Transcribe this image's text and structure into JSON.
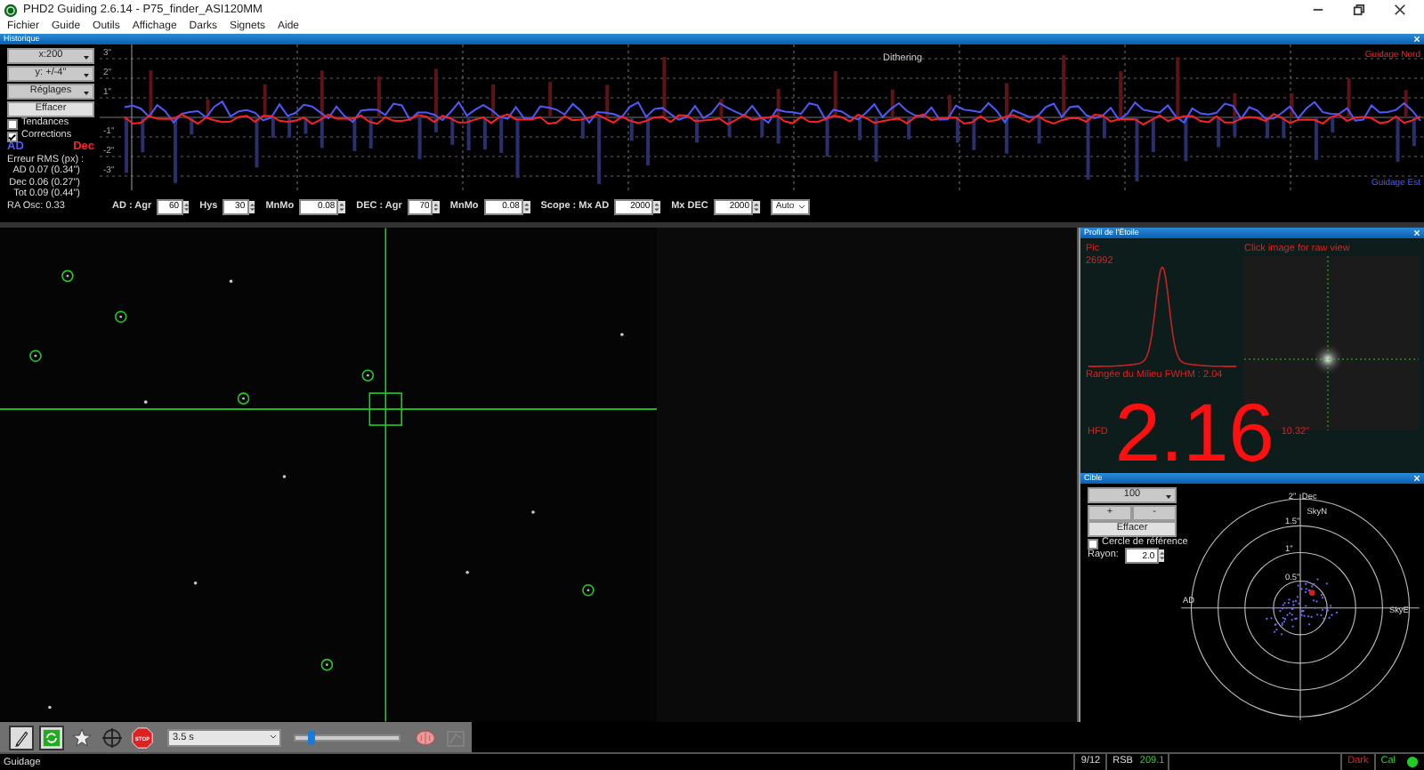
{
  "window": {
    "title": "PHD2 Guiding 2.6.14 - P75_finder_ASI120MM"
  },
  "menu": [
    "Fichier",
    "Guide",
    "Outils",
    "Affichage",
    "Darks",
    "Signets",
    "Aide"
  ],
  "history": {
    "title": "Historique",
    "x_scale": "x:200",
    "y_scale": "y: +/-4\"",
    "settings": "Réglages",
    "clear": "Effacer",
    "options": [
      {
        "label": "Tendances",
        "checked": false
      },
      {
        "label": "Corrections",
        "checked": true
      }
    ],
    "legend": [
      {
        "label": "AD",
        "color": "#4a5cff"
      },
      {
        "label": "Dec",
        "color": "#ff2020"
      }
    ],
    "rms_title": "Erreur RMS (px) :",
    "rms": [
      "AD 0.07 (0.34\")",
      "Dec 0.06 (0.27\")",
      "Tot 0.09 (0.44\")"
    ],
    "ra_osc": "RA Osc: 0.33",
    "y_ticks": [
      "3\"",
      "2\"",
      "1\"",
      "-1\"",
      "-2\"",
      "-3\""
    ],
    "annotation": "Dithering",
    "north_label": "Guidage Nord",
    "east_label": "Guidage Est",
    "params": [
      {
        "label": "AD : Agr",
        "value": "60"
      },
      {
        "label": "Hys",
        "value": "30"
      },
      {
        "label": "MnMo",
        "value": "0.08"
      },
      {
        "label": "DEC : Agr",
        "value": "70"
      },
      {
        "label": "MnMo",
        "value": "0.08"
      },
      {
        "label": "Scope : Mx AD",
        "value": "2000"
      },
      {
        "label": "Mx DEC",
        "value": "2000"
      }
    ],
    "dec_mode": "Auto"
  },
  "profile": {
    "title": "Profil de l'Étoile",
    "peak_label": "Pic",
    "peak": "26992",
    "hint": "Click image for raw view",
    "fwhm": "Rangée du Milieu FWHM : 2.04",
    "hfd_label": "HFD",
    "hfd": "2.16",
    "hfd_arcsec": "10.32\""
  },
  "target": {
    "title": "Cible",
    "scale": "100",
    "zoom_in": "+",
    "zoom_out": "-",
    "clear": "Effacer",
    "reference_circle": {
      "label": "Cercle de référence",
      "checked": false
    },
    "radius_label": "Rayon:",
    "radius": "2.0",
    "ring_labels": [
      "2\"",
      "1.5\"",
      "1\"",
      "0.5\""
    ],
    "dec_label": "Dec",
    "north_label": "SkyN",
    "ra_label": "AD",
    "east_label": "SkyE"
  },
  "toolbar": {
    "exposure": "3.5 s",
    "stop": "STOP",
    "level": 0.12
  },
  "status_bar": {
    "message": "Guidage",
    "frames": "9/12",
    "snr_label": "RSB",
    "snr": "209.1",
    "dark": {
      "label": "Dark",
      "active": false
    },
    "calibration": {
      "label": "Cal",
      "active": true
    }
  }
}
